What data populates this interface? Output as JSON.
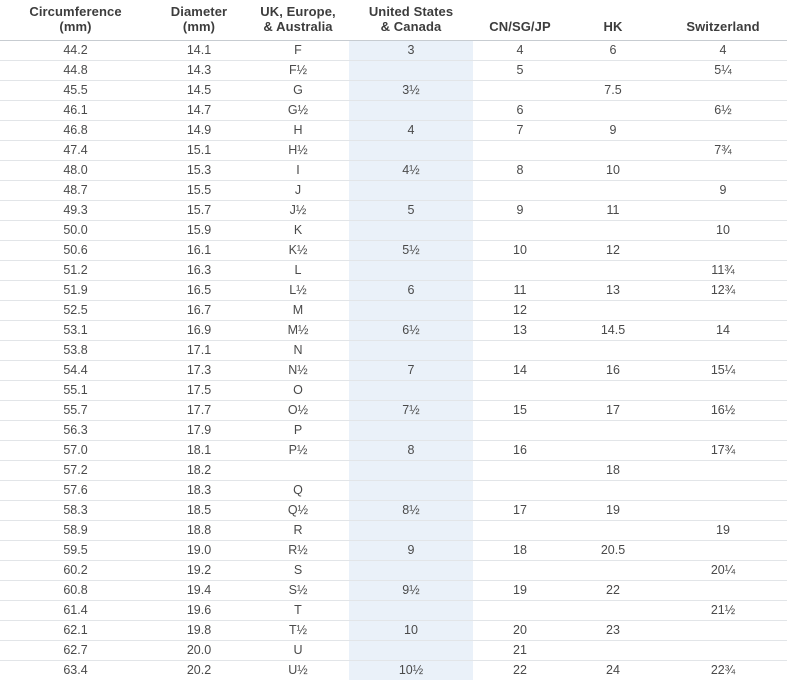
{
  "table": {
    "name": "ring-size-conversion-table",
    "highlight_color": "#eaf1f9",
    "header_rule_color": "#c7ccd1",
    "row_rule_color": "#e2e5e8",
    "columns": [
      {
        "key": "circumference",
        "line1": "Circumference",
        "line2": "(mm)"
      },
      {
        "key": "diameter",
        "line1": "Diameter",
        "line2": "(mm)"
      },
      {
        "key": "uk",
        "line1": "UK, Europe,",
        "line2": "& Australia"
      },
      {
        "key": "us",
        "line1": "United States",
        "line2": "& Canada"
      },
      {
        "key": "cn",
        "line1": "CN/SG/JP",
        "line2": ""
      },
      {
        "key": "hk",
        "line1": "HK",
        "line2": ""
      },
      {
        "key": "ch",
        "line1": "Switzerland",
        "line2": ""
      }
    ],
    "rows": [
      [
        "44.2",
        "14.1",
        "F",
        "3",
        "4",
        "6",
        "4"
      ],
      [
        "44.8",
        "14.3",
        "F½",
        "",
        "5",
        "",
        "5¼"
      ],
      [
        "45.5",
        "14.5",
        "G",
        "3½",
        "",
        "7.5",
        ""
      ],
      [
        "46.1",
        "14.7",
        "G½",
        "",
        "6",
        "",
        "6½"
      ],
      [
        "46.8",
        "14.9",
        "H",
        "4",
        "7",
        "9",
        ""
      ],
      [
        "47.4",
        "15.1",
        "H½",
        "",
        "",
        "",
        "7¾"
      ],
      [
        "48.0",
        "15.3",
        "I",
        "4½",
        "8",
        "10",
        ""
      ],
      [
        "48.7",
        "15.5",
        "J",
        "",
        "",
        "",
        "9"
      ],
      [
        "49.3",
        "15.7",
        "J½",
        "5",
        "9",
        "11",
        ""
      ],
      [
        "50.0",
        "15.9",
        "K",
        "",
        "",
        "",
        "10"
      ],
      [
        "50.6",
        "16.1",
        "K½",
        "5½",
        "10",
        "12",
        ""
      ],
      [
        "51.2",
        "16.3",
        "L",
        "",
        "",
        "",
        "11¾"
      ],
      [
        "51.9",
        "16.5",
        "L½",
        "6",
        "11",
        "13",
        "12¾"
      ],
      [
        "52.5",
        "16.7",
        "M",
        "",
        "12",
        "",
        ""
      ],
      [
        "53.1",
        "16.9",
        "M½",
        "6½",
        "13",
        "14.5",
        "14"
      ],
      [
        "53.8",
        "17.1",
        "N",
        "",
        "",
        "",
        ""
      ],
      [
        "54.4",
        "17.3",
        "N½",
        "7",
        "14",
        "16",
        "15¼"
      ],
      [
        "55.1",
        "17.5",
        "O",
        "",
        "",
        "",
        ""
      ],
      [
        "55.7",
        "17.7",
        "O½",
        "7½",
        "15",
        "17",
        "16½"
      ],
      [
        "56.3",
        "17.9",
        "P",
        "",
        "",
        "",
        ""
      ],
      [
        "57.0",
        "18.1",
        "P½",
        "8",
        "16",
        "",
        "17¾"
      ],
      [
        "57.2",
        "18.2",
        "",
        "",
        "",
        "18",
        ""
      ],
      [
        "57.6",
        "18.3",
        "Q",
        "",
        "",
        "",
        ""
      ],
      [
        "58.3",
        "18.5",
        "Q½",
        "8½",
        "17",
        "19",
        ""
      ],
      [
        "58.9",
        "18.8",
        "R",
        "",
        "",
        "",
        "19"
      ],
      [
        "59.5",
        "19.0",
        "R½",
        "9",
        "18",
        "20.5",
        ""
      ],
      [
        "60.2",
        "19.2",
        "S",
        "",
        "",
        "",
        "20¼"
      ],
      [
        "60.8",
        "19.4",
        "S½",
        "9½",
        "19",
        "22",
        ""
      ],
      [
        "61.4",
        "19.6",
        "T",
        "",
        "",
        "",
        "21½"
      ],
      [
        "62.1",
        "19.8",
        "T½",
        "10",
        "20",
        "23",
        ""
      ],
      [
        "62.7",
        "20.0",
        "U",
        "",
        "21",
        "",
        ""
      ],
      [
        "63.4",
        "20.2",
        "U½",
        "10½",
        "22",
        "24",
        "22¾"
      ]
    ]
  }
}
